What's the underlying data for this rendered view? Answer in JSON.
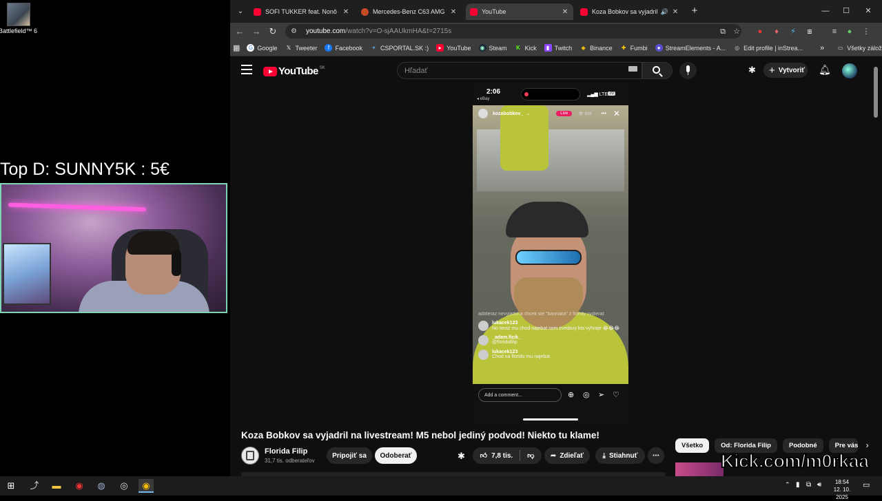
{
  "desktop": {
    "icon_label": "Battlefield™ 6"
  },
  "overlay": {
    "donation_text": "Top D: SUNNY5K : 5€",
    "watermark": "Kick.com/m0rkaa"
  },
  "tabs": [
    {
      "title": "SOFI TUKKER feat. Nonô - \"Pick",
      "icon": "youtube-icon",
      "active": false
    },
    {
      "title": "Mercedes-Benz C63 AMG 6.2 V",
      "icon": "mercedes-icon",
      "active": false
    },
    {
      "title": "YouTube",
      "icon": "youtube-icon",
      "active": true
    },
    {
      "title": "Koza Bobkov sa vyjadril na",
      "icon": "youtube-icon",
      "active": false
    }
  ],
  "address": {
    "host": "youtube.com",
    "path": "/watch?v=O-sjAAUkmHA&t=2715s"
  },
  "bookmarks": [
    {
      "label": "Google",
      "icon": "google-icon",
      "color": "#4285f4"
    },
    {
      "label": "Tweeter",
      "icon": "x-icon",
      "color": "#000000"
    },
    {
      "label": "Facebook",
      "icon": "facebook-icon",
      "color": "#1877f2"
    },
    {
      "label": "CSPORTAL.SK :)",
      "icon": "csportal-icon",
      "color": "#2b6cb0"
    },
    {
      "label": "YouTube",
      "icon": "youtube-icon",
      "color": "#ff0033"
    },
    {
      "label": "Steam",
      "icon": "steam-icon",
      "color": "#1b2838"
    },
    {
      "label": "Kick",
      "icon": "kick-icon",
      "color": "#53fc18"
    },
    {
      "label": "Twitch",
      "icon": "twitch-icon",
      "color": "#9146ff"
    },
    {
      "label": "Binance",
      "icon": "binance-icon",
      "color": "#f0b90b"
    },
    {
      "label": "Fumbi",
      "icon": "fumbi-icon",
      "color": "#ffcc00"
    },
    {
      "label": "StreamElements - A...",
      "icon": "streamelements-icon",
      "color": "#5a4fcf"
    },
    {
      "label": "Edit profile | inStrea...",
      "icon": "globe-icon",
      "color": "#888888"
    }
  ],
  "bookmarks_all": "Všetky záložky",
  "youtube": {
    "logo": "YouTube",
    "country": "SK",
    "search_placeholder": "Hľadať",
    "create_label": "Vytvoriť"
  },
  "stream": {
    "time": "2:06",
    "carrier": "◂ eBay",
    "network": "LTE",
    "battery": "70",
    "username": "kozabobkov_",
    "live_badge": "Live",
    "viewers": "608",
    "comments": [
      {
        "user": "",
        "text": "adoteraz nevyjadril a chcek ste \"bannaka\" z floridy vydierat"
      },
      {
        "user": "lukacek123",
        "text": "No teraz mu chod najebat som zvedavy kto vyhraje 😂😂😂"
      },
      {
        "user": "_adam.ficik_",
        "text": "@floridafilip"
      },
      {
        "user": "lukacek123",
        "text": "Chod na floridu mu najebat"
      }
    ],
    "comment_placeholder": "Add a comment..."
  },
  "video": {
    "title": "Koza Bobkov sa vyjadril na livestream! M5 nebol jediný podvod! Niekto tu klame!",
    "channel": "Florida Filip",
    "subscribers": "31,7 tis. odberateľov",
    "join_label": "Pripojiť sa",
    "subscribe_label": "Odoberať",
    "likes": "7,8 tis.",
    "share_label": "Zdieľať",
    "download_label": "Stiahnuť"
  },
  "chips": [
    "Všetko",
    "Od: Florida Filip",
    "Podobné",
    "Pre vás"
  ],
  "clock": {
    "time": "18:54",
    "date": "12. 10. 2025"
  },
  "colors": {
    "accent_red": "#ff0033",
    "kick_green": "#53fc18",
    "webcam_border": "#7fd6b4"
  }
}
